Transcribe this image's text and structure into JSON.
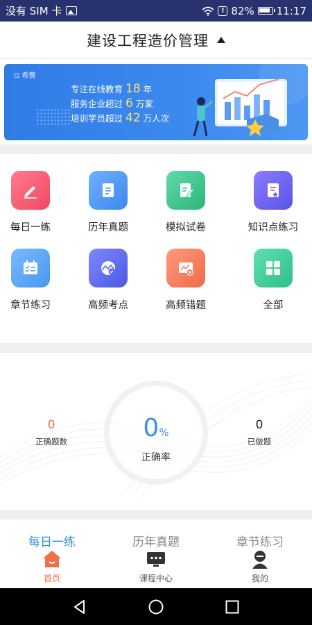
{
  "status_bar": {
    "carrier": "没有 SIM 卡",
    "battery": "82%",
    "time": "11:17"
  },
  "header": {
    "title": "建设工程造价管理"
  },
  "banner": {
    "logo": "⊡ 希赛",
    "line1_pre": "专注在线教育",
    "line1_num": "18",
    "line1_post": "年",
    "line2_pre": "服务企业超过",
    "line2_num": "6",
    "line2_post": "万家",
    "line3_pre": "培训学员超过",
    "line3_num": "42",
    "line3_post": "万人次"
  },
  "grid": {
    "items": [
      {
        "label": "每日一练",
        "color": "#f3566f",
        "icon": "pencil-icon"
      },
      {
        "label": "历年真题",
        "color": "#4f9af3",
        "icon": "document-icon"
      },
      {
        "label": "模拟试卷",
        "color": "#3fc48f",
        "icon": "exam-paper-icon"
      },
      {
        "label": "知识点练习",
        "color": "#6b62ee",
        "icon": "knowledge-icon"
      },
      {
        "label": "章节练习",
        "color": "#58a6f4",
        "icon": "checklist-icon"
      },
      {
        "label": "高频考点",
        "color": "#5a68ec",
        "icon": "mountain-check-icon"
      },
      {
        "label": "高频错题",
        "color": "#f57f5c",
        "icon": "chart-error-icon"
      },
      {
        "label": "全部",
        "color": "#3fd09c",
        "icon": "grid-icon"
      }
    ]
  },
  "stats": {
    "correct_count": "0",
    "correct_count_label": "正确题数",
    "rate_value": "0",
    "rate_unit": "%",
    "rate_label": "正确率",
    "done_count": "0",
    "done_label": "已做题"
  },
  "tabs": [
    "每日一练",
    "历年真题",
    "章节练习"
  ],
  "bottom_nav": [
    {
      "label": "首页",
      "icon": "home-icon"
    },
    {
      "label": "课程中心",
      "icon": "course-icon"
    },
    {
      "label": "我的",
      "icon": "profile-icon"
    }
  ],
  "colors": {
    "accent": "#2a8ae5",
    "active_nav": "#f36f46",
    "status_bar": "#27326e"
  }
}
